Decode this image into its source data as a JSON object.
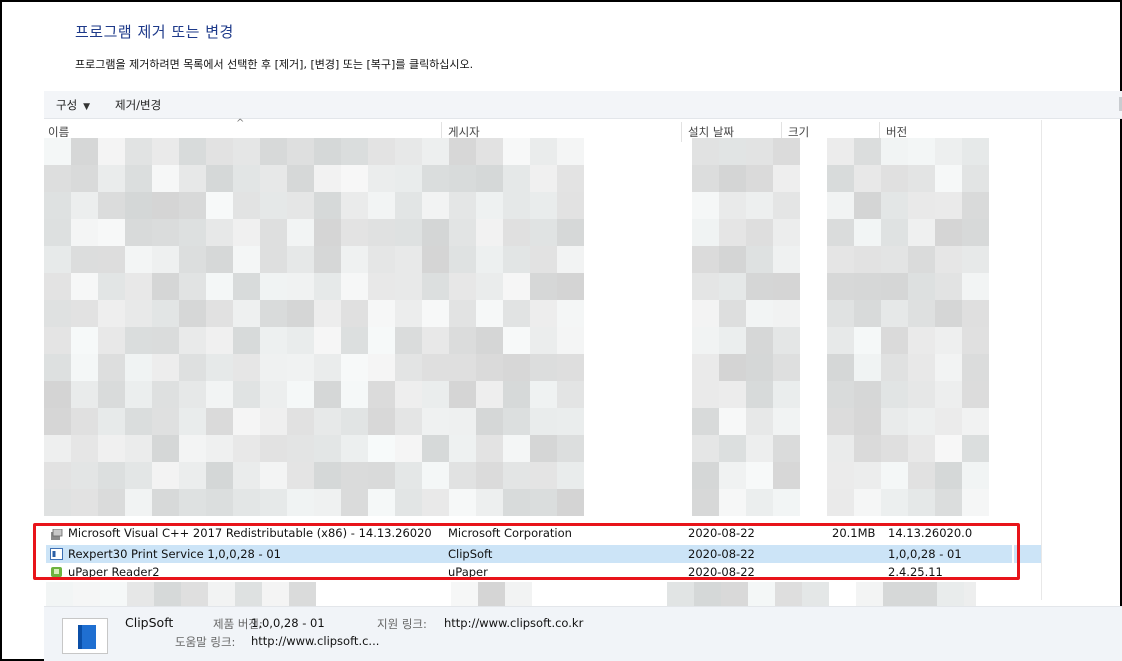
{
  "header": {
    "title": "프로그램 제거 또는 변경",
    "description": "프로그램을 제거하려면 목록에서 선택한 후 [제거], [변경] 또는 [복구]를 클릭하십시오."
  },
  "toolbar": {
    "organize_label": "구성",
    "uninstall_change_label": "제거/변경"
  },
  "columns": {
    "name": "이름",
    "publisher": "게시자",
    "installed_on": "설치 날짜",
    "size": "크기",
    "version": "버전"
  },
  "rows": [
    {
      "name": "Microsoft Visual C++ 2017 Redistributable (x86) - 14.13.26020",
      "publisher": "Microsoft Corporation",
      "installed_on": "2020-08-22",
      "size": "20.1MB",
      "version": "14.13.26020.0",
      "icon": "installer-icon"
    },
    {
      "name": "Rexpert30 Print Service 1,0,0,28 - 01",
      "publisher": "ClipSoft",
      "installed_on": "2020-08-22",
      "size": "",
      "version": "1,0,0,28 - 01",
      "icon": "app-window-icon",
      "selected": true
    },
    {
      "name": "uPaper Reader2",
      "publisher": "uPaper",
      "installed_on": "2020-08-22",
      "size": "",
      "version": "2.4.25.11",
      "icon": "uppaper-icon"
    }
  ],
  "details": {
    "publisher": "ClipSoft",
    "product_version_label": "제품 버전:",
    "product_version": "1,0,0,28 - 01",
    "support_link_label": "지원 링크:",
    "support_link": "http://www.clipsoft.co.kr",
    "help_link_label": "도움말 링크:",
    "help_link": "http://www.clipsoft.c..."
  },
  "colors": {
    "title": "#1e3a8a",
    "selection": "#cce4f7",
    "highlight_box": "#e8141a"
  }
}
